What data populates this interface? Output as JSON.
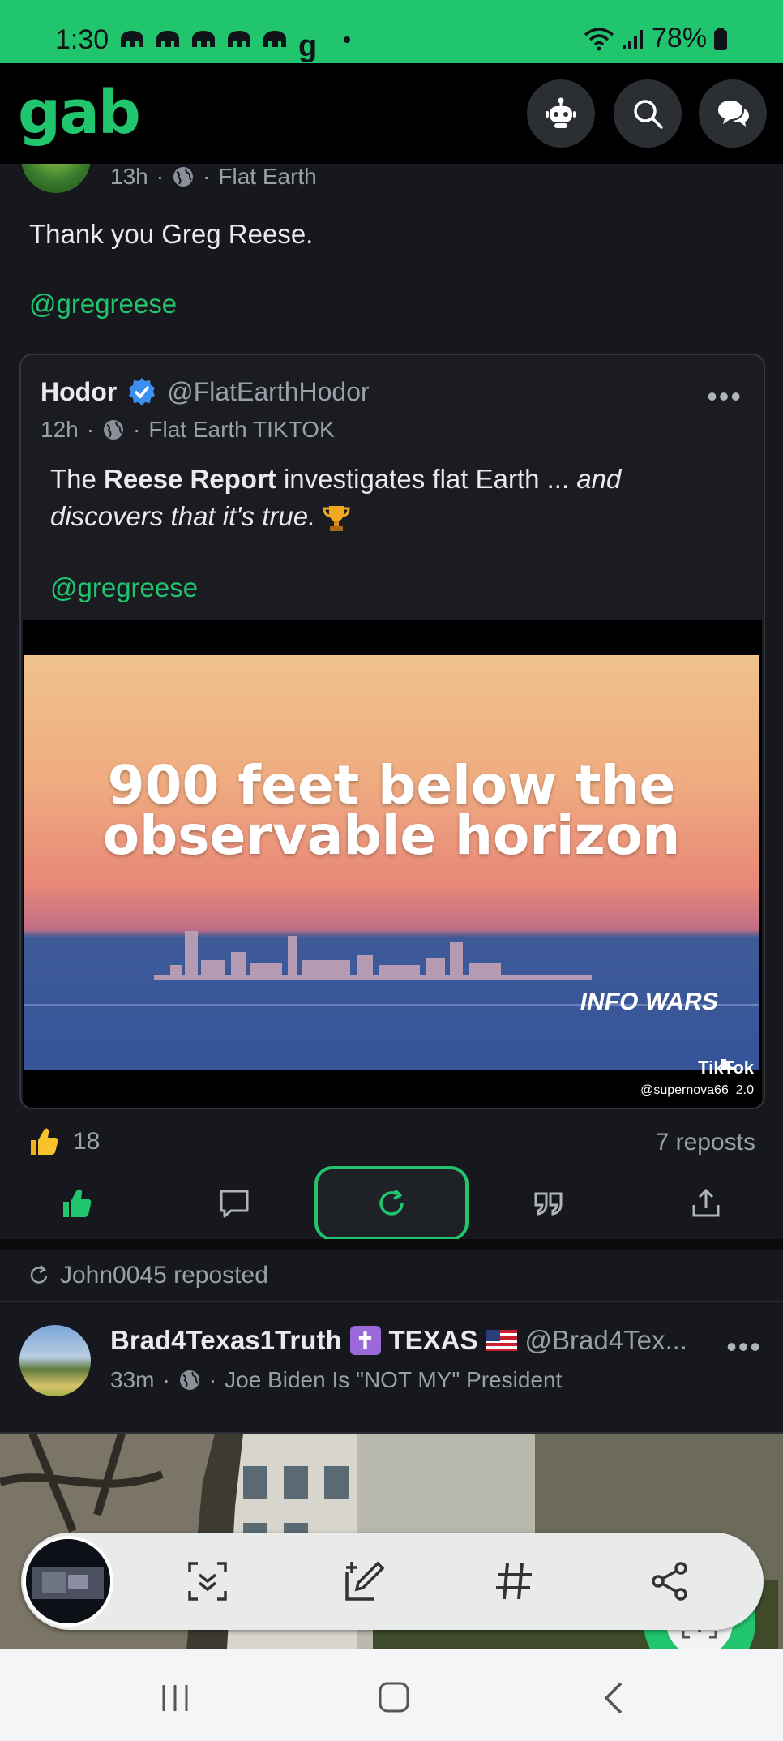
{
  "status_bar": {
    "time": "1:30",
    "gmail_glyph": "g",
    "battery": "78%"
  },
  "header": {
    "logo": "gab"
  },
  "post1": {
    "time": "13h",
    "group": "Flat Earth",
    "text": "Thank you Greg Reese.",
    "mention": "@gregreese",
    "quote": {
      "name": "Hodor",
      "handle": "@FlatEarthHodor",
      "time": "12h",
      "group": "Flat Earth TIKTOK",
      "text_pre": "The ",
      "text_bold": "Reese Report",
      "text_mid": " investigates flat Earth ... ",
      "text_italic": "and discovers that it's true.",
      "mention": "@gregreese",
      "video": {
        "caption_line1": "900 feet below the",
        "caption_line2": "observable horizon",
        "watermark": "INFO WARS",
        "tiktok": "TikTok",
        "tiktok_user": "@supernova66_2.0"
      }
    },
    "likes": "18",
    "reposts": "7 reposts"
  },
  "repost_label": "John0045 reposted",
  "post2": {
    "name": "Brad4Texas1Truth",
    "badge": "✝",
    "name_suffix": "TEXAS",
    "handle": "@Brad4Tex...",
    "time": "33m",
    "group": "Joe Biden Is \"NOT MY\" President"
  },
  "colors": {
    "accent": "#21c56e",
    "background": "#16181d"
  }
}
